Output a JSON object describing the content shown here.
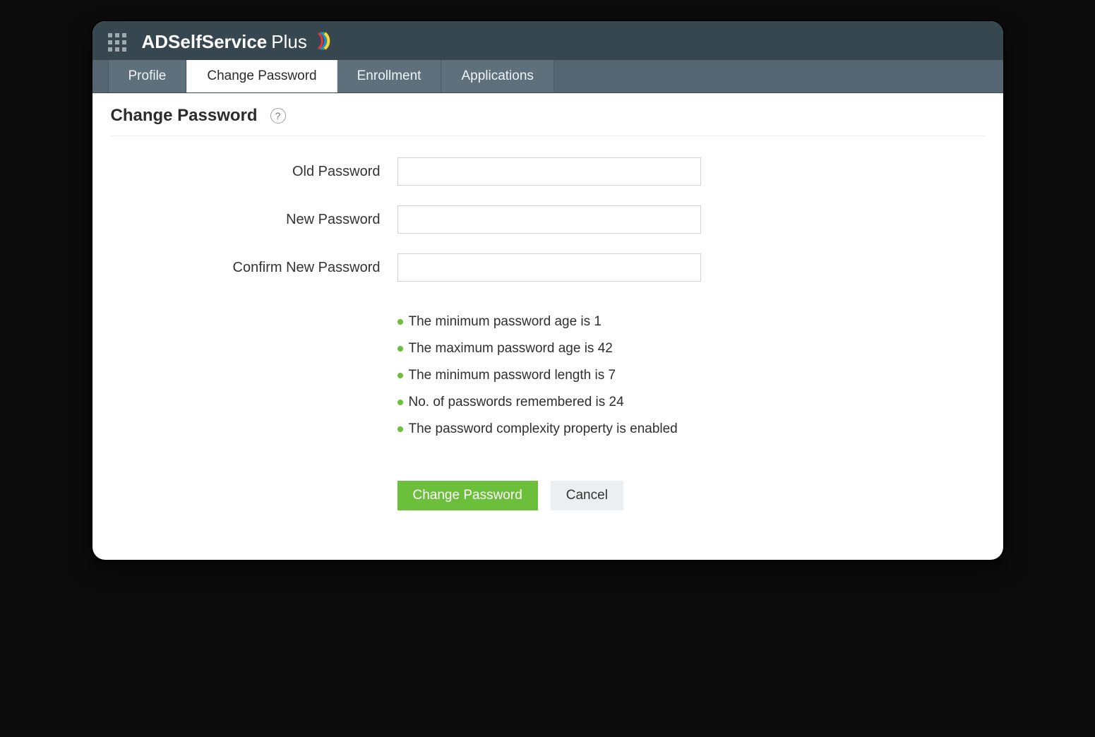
{
  "brand": {
    "name_bold": "ADSelfService",
    "name_light": "Plus"
  },
  "tabs": [
    {
      "label": "Profile",
      "active": false
    },
    {
      "label": "Change Password",
      "active": true
    },
    {
      "label": "Enrollment",
      "active": false
    },
    {
      "label": "Applications",
      "active": false
    }
  ],
  "page": {
    "title": "Change Password"
  },
  "form": {
    "old_password_label": "Old Password",
    "new_password_label": "New Password",
    "confirm_password_label": "Confirm New Password",
    "old_password_value": "",
    "new_password_value": "",
    "confirm_password_value": ""
  },
  "rules": [
    "The minimum password age is 1",
    "The maximum password age is 42",
    "The minimum password length is 7",
    "No. of passwords remembered is 24",
    "The password complexity property is enabled"
  ],
  "actions": {
    "primary": "Change Password",
    "secondary": "Cancel"
  }
}
